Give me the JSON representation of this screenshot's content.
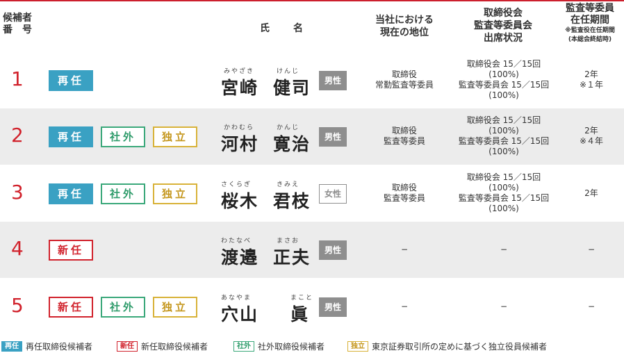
{
  "header": {
    "number": [
      "候補者",
      "番　号"
    ],
    "name": "氏　名",
    "position": [
      "当社における",
      "現在の地位"
    ],
    "attendance": [
      "取締役会",
      "監査等委員会",
      "出席状況"
    ],
    "term": [
      "監査等委員",
      "在任期間"
    ],
    "term_note": [
      "※監査役在任期間",
      "(本総会終結時)"
    ]
  },
  "tags": {
    "reappoint": "再任",
    "new": "新任",
    "outside": "社外",
    "independent": "独立"
  },
  "candidates": [
    {
      "number": "1",
      "tags": [
        "reappoint"
      ],
      "ruby_family": "みやざき",
      "ruby_given": "けんじ",
      "family": "宮崎",
      "given": "健司",
      "sex": "男性",
      "position": [
        "取締役",
        "常勤監査等委員"
      ],
      "attendance": [
        "取締役会 15／15回",
        "(100%)",
        "監査等委員会 15／15回",
        "(100%)"
      ],
      "term": [
        "2年",
        "※１年"
      ]
    },
    {
      "number": "2",
      "tags": [
        "reappoint",
        "outside",
        "independent"
      ],
      "ruby_family": "かわむら",
      "ruby_given": "かんじ",
      "family": "河村",
      "given": "寛治",
      "sex": "男性",
      "position": [
        "取締役",
        "監査等委員"
      ],
      "attendance": [
        "取締役会 15／15回",
        "(100%)",
        "監査等委員会 15／15回",
        "(100%)"
      ],
      "term": [
        "2年",
        "※４年"
      ]
    },
    {
      "number": "3",
      "tags": [
        "reappoint",
        "outside",
        "independent"
      ],
      "ruby_family": "さくらぎ",
      "ruby_given": "きみえ",
      "family": "桜木",
      "given": "君枝",
      "sex": "女性",
      "position": [
        "取締役",
        "監査等委員"
      ],
      "attendance": [
        "取締役会 15／15回",
        "(100%)",
        "監査等委員会 15／15回",
        "(100%)"
      ],
      "term": [
        "2年"
      ]
    },
    {
      "number": "4",
      "tags": [
        "new"
      ],
      "ruby_family": "わたなべ",
      "ruby_given": "まさお",
      "family": "渡邉",
      "given": "正夫",
      "sex": "男性",
      "position": [
        "−"
      ],
      "attendance": [
        "−"
      ],
      "term": [
        "−"
      ]
    },
    {
      "number": "5",
      "tags": [
        "new",
        "outside",
        "independent"
      ],
      "ruby_family": "あなやま",
      "ruby_given": "まこと",
      "family": "穴山",
      "given": "眞",
      "sex": "男性",
      "position": [
        "−"
      ],
      "attendance": [
        "−"
      ],
      "term": [
        "−"
      ]
    }
  ],
  "legend": [
    {
      "tag": "再任",
      "text": "再任取締役候補者"
    },
    {
      "tag": "新任",
      "text": "新任取締役候補者"
    },
    {
      "tag": "社外",
      "text": "社外取締役候補者"
    },
    {
      "tag": "独立",
      "text": "東京証券取引所の定めに基づく独立役員候補者"
    }
  ],
  "colors": {
    "number_red": "#d1222c",
    "reappoint_blue": "#3aa1c3",
    "outside_green": "#3aa87a",
    "independent_gold": "#d8b238",
    "male_gray": "#8e8e8e",
    "row_shade": "#ececec"
  }
}
